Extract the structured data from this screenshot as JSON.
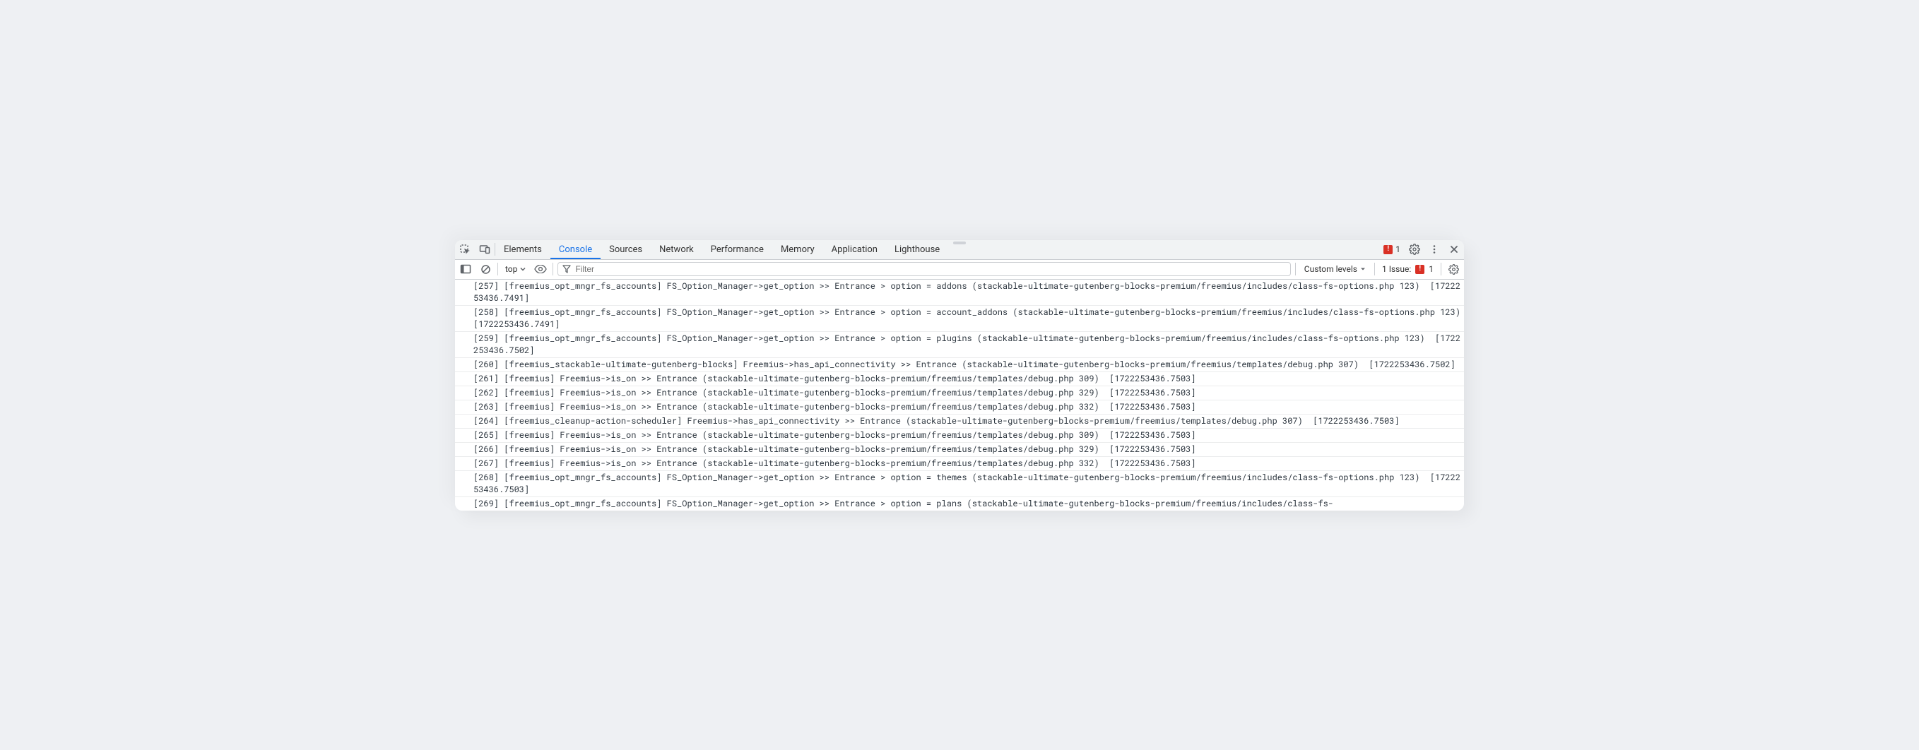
{
  "tabs": {
    "elements": "Elements",
    "console": "Console",
    "sources": "Sources",
    "network": "Network",
    "performance": "Performance",
    "memory": "Memory",
    "application": "Application",
    "lighthouse": "Lighthouse"
  },
  "tabbar_error_count": "1",
  "toolbar": {
    "context": "top",
    "filter_placeholder": "Filter",
    "levels": "Custom levels",
    "issues_label": "1 Issue:",
    "issues_count": "1"
  },
  "logs": [
    "[257] [freemius_opt_mngr_fs_accounts] FS_Option_Manager->get_option >> Entrance > option = addons (stackable-ultimate-gutenberg-blocks-premium/freemius/includes/class-fs-options.php 123)  [1722253436.7491]",
    "[258] [freemius_opt_mngr_fs_accounts] FS_Option_Manager->get_option >> Entrance > option = account_addons (stackable-ultimate-gutenberg-blocks-premium/freemius/includes/class-fs-options.php 123)  [1722253436.7491]",
    "[259] [freemius_opt_mngr_fs_accounts] FS_Option_Manager->get_option >> Entrance > option = plugins (stackable-ultimate-gutenberg-blocks-premium/freemius/includes/class-fs-options.php 123)  [1722253436.7502]",
    "[260] [freemius_stackable-ultimate-gutenberg-blocks] Freemius->has_api_connectivity >> Entrance (stackable-ultimate-gutenberg-blocks-premium/freemius/templates/debug.php 307)  [1722253436.7502]",
    "[261] [freemius] Freemius->is_on >> Entrance (stackable-ultimate-gutenberg-blocks-premium/freemius/templates/debug.php 309)  [1722253436.7503]",
    "[262] [freemius] Freemius->is_on >> Entrance (stackable-ultimate-gutenberg-blocks-premium/freemius/templates/debug.php 329)  [1722253436.7503]",
    "[263] [freemius] Freemius->is_on >> Entrance (stackable-ultimate-gutenberg-blocks-premium/freemius/templates/debug.php 332)  [1722253436.7503]",
    "[264] [freemius_cleanup-action-scheduler] Freemius->has_api_connectivity >> Entrance (stackable-ultimate-gutenberg-blocks-premium/freemius/templates/debug.php 307)  [1722253436.7503]",
    "[265] [freemius] Freemius->is_on >> Entrance (stackable-ultimate-gutenberg-blocks-premium/freemius/templates/debug.php 309)  [1722253436.7503]",
    "[266] [freemius] Freemius->is_on >> Entrance (stackable-ultimate-gutenberg-blocks-premium/freemius/templates/debug.php 329)  [1722253436.7503]",
    "[267] [freemius] Freemius->is_on >> Entrance (stackable-ultimate-gutenberg-blocks-premium/freemius/templates/debug.php 332)  [1722253436.7503]",
    "[268] [freemius_opt_mngr_fs_accounts] FS_Option_Manager->get_option >> Entrance > option = themes (stackable-ultimate-gutenberg-blocks-premium/freemius/includes/class-fs-options.php 123)  [1722253436.7503]",
    "[269] [freemius_opt_mngr_fs_accounts] FS_Option_Manager->get_option >> Entrance > option = plans (stackable-ultimate-gutenberg-blocks-premium/freemius/includes/class-fs-"
  ]
}
